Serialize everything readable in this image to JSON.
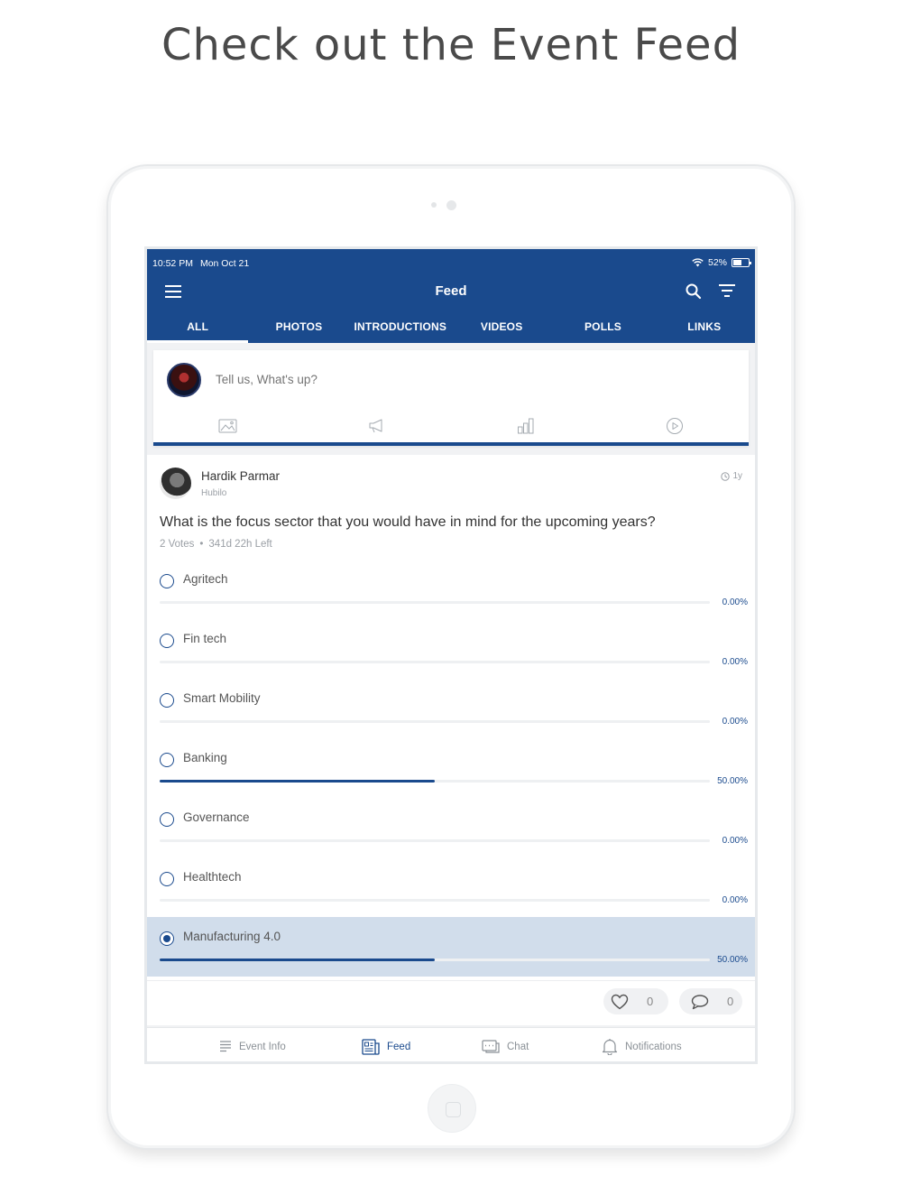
{
  "headline": "Check out the Event Feed",
  "status_bar": {
    "time": "10:52 PM",
    "date": "Mon Oct 21",
    "battery": "52%"
  },
  "header": {
    "title": "Feed"
  },
  "tabs": [
    {
      "label": "ALL",
      "active": true
    },
    {
      "label": "PHOTOS"
    },
    {
      "label": "INTRODUCTIONS"
    },
    {
      "label": "VIDEOS"
    },
    {
      "label": "POLLS"
    },
    {
      "label": "LINKS"
    }
  ],
  "composer": {
    "placeholder": "Tell us, What's up?"
  },
  "post": {
    "author": "Hardik Parmar",
    "organization": "Hubilo",
    "time": "1y",
    "question": "What is the focus sector that you would have in mind for the upcoming years?",
    "votes": "2 Votes",
    "time_left": "341d 22h Left",
    "options": [
      {
        "label": "Agritech",
        "percent": 0,
        "percent_text": "0.00%",
        "selected": false
      },
      {
        "label": "Fin tech",
        "percent": 0,
        "percent_text": "0.00%",
        "selected": false
      },
      {
        "label": "Smart Mobility",
        "percent": 0,
        "percent_text": "0.00%",
        "selected": false
      },
      {
        "label": "Banking",
        "percent": 50,
        "percent_text": "50.00%",
        "selected": false
      },
      {
        "label": "Governance",
        "percent": 0,
        "percent_text": "0.00%",
        "selected": false
      },
      {
        "label": "Healthtech",
        "percent": 0,
        "percent_text": "0.00%",
        "selected": false
      },
      {
        "label": "Manufacturing 4.0",
        "percent": 50,
        "percent_text": "50.00%",
        "selected": true
      }
    ],
    "likes": "0",
    "comments": "0"
  },
  "bottom_nav": [
    {
      "label": "Event Info",
      "icon": "list-icon"
    },
    {
      "label": "Feed",
      "icon": "feed-icon",
      "active": true
    },
    {
      "label": "Chat",
      "icon": "chat-icon"
    },
    {
      "label": "Notifications",
      "icon": "bell-icon"
    }
  ],
  "colors": {
    "primary": "#1a4a8d",
    "selected_row": "#d1ddeb"
  }
}
